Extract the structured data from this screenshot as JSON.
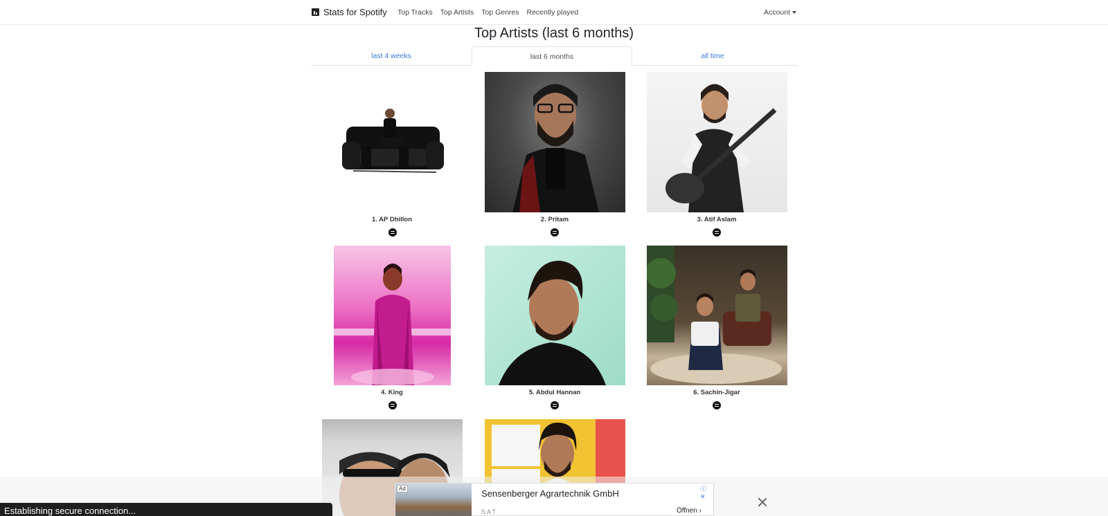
{
  "navbar": {
    "brand": "Stats for Spotify",
    "links": [
      "Top Tracks",
      "Top Artists",
      "Top Genres",
      "Recently played"
    ],
    "account": "Account"
  },
  "page": {
    "title": "Top Artists (last 6 months)"
  },
  "tabs": [
    {
      "label": "last 4 weeks",
      "active": false
    },
    {
      "label": "last 6 months",
      "active": true
    },
    {
      "label": "all time",
      "active": false
    }
  ],
  "artists": [
    {
      "label": "1. AP Dhillon"
    },
    {
      "label": "2. Pritam"
    },
    {
      "label": "3. Atif Aslam"
    },
    {
      "label": "4. King"
    },
    {
      "label": "5. Abdul Hannan"
    },
    {
      "label": "6. Sachin-Jigar"
    }
  ],
  "ad": {
    "badge": "Ad",
    "title": "Sensenberger Agrartechnik GmbH",
    "subtitle": "SAT",
    "cta": "Öffnen ›",
    "info": "ⓘ ✕"
  },
  "status": "Establishing secure connection..."
}
